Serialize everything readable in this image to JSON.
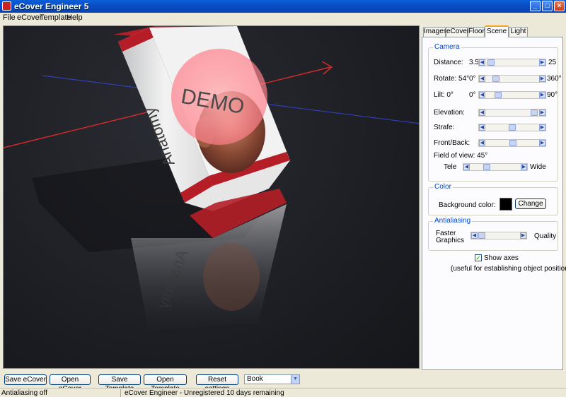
{
  "window": {
    "title": "eCover Engineer 5",
    "minimize": "_",
    "maximize": "□",
    "close": "×"
  },
  "menu": [
    "File",
    "eCover",
    "Template",
    "Help"
  ],
  "tabs": [
    "Images",
    "eCover",
    "Floor",
    "Scene",
    "Light"
  ],
  "active_tab": "Scene",
  "viewport": {
    "spine_text": "Anatomy",
    "reflection_text": "Anatomy",
    "watermark": "DEMO"
  },
  "camera": {
    "title": "Camera",
    "distance": {
      "label": "Distance:",
      "min": "3.5",
      "max": "25",
      "level": 0.05
    },
    "rotate": {
      "label": "Rotate: 54°",
      "min": "0°",
      "max": "360°",
      "level": 0.15
    },
    "tilt": {
      "label": "Lilt: 0°",
      "min": "0°",
      "max": "90°",
      "level": 0.2
    },
    "elevation": {
      "label": "Elevation:",
      "level": 0.97
    },
    "strafe": {
      "label": "Strafe:",
      "level": 0.5
    },
    "frontback": {
      "label": "Front/Back:",
      "level": 0.52
    },
    "fov": {
      "label": "Field of view: 45°",
      "min": "Tele",
      "max": "Wide",
      "level": 0.3
    }
  },
  "color": {
    "title": "Color",
    "label": "Background color:",
    "button": "Change",
    "value": "#000000"
  },
  "antialiasing": {
    "title": "Antialiasing",
    "min": "Faster Graphics",
    "max": "Quality",
    "level": 0.02
  },
  "axes": {
    "label": "Show axes",
    "checked": "✓",
    "hint": "(useful for establishing object position)"
  },
  "toolbar": {
    "save_ecover": "Save eCover",
    "open_ecover": "Open eCover",
    "save_template": "Save Template",
    "open_template": "Open Template",
    "reset": "Reset settings",
    "select_value": "Book",
    "select_arrow": "▼"
  },
  "status": {
    "left": "Antialiasing off",
    "right": "eCover Engineer - Unregistered 10 days remaining"
  }
}
